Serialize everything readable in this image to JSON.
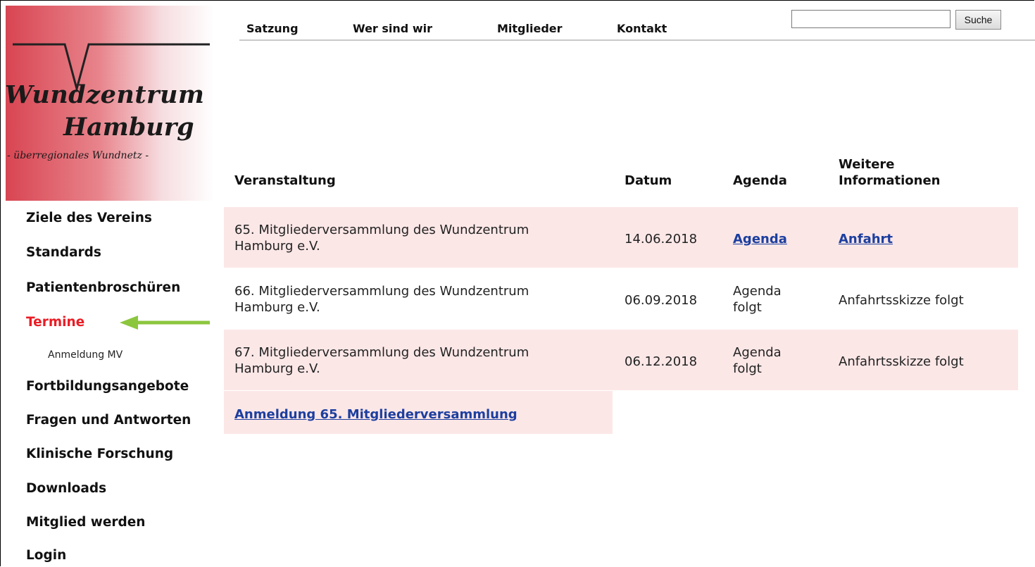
{
  "logo": {
    "line1": "Wundzentrum",
    "line2": "Hamburg",
    "subtitle": "- überregionales Wundnetz -"
  },
  "topnav": {
    "items": [
      "Satzung",
      "Wer sind wir",
      "Mitglieder",
      "Kontakt"
    ]
  },
  "search": {
    "value": "",
    "button_label": "Suche"
  },
  "sidebar": {
    "items": [
      "Ziele des Vereins",
      "Standards",
      "Patientenbroschüren",
      "Termine",
      "Anmeldung MV",
      "Fortbildungsangebote",
      "Fragen und Antworten",
      "Klinische Forschung",
      "Downloads",
      "Mitglied werden",
      "Login"
    ],
    "active": "Termine"
  },
  "table": {
    "headers": {
      "event": "Veranstaltung",
      "date": "Datum",
      "agenda": "Agenda",
      "info_line1": "Weitere",
      "info_line2": "Informationen"
    },
    "rows": [
      {
        "event_line1": "65. Mitgliederversammlung des Wundzentrum",
        "event_line2": "Hamburg e.V.",
        "date": "14.06.2018",
        "agenda": "Agenda",
        "info": "Anfahrt"
      },
      {
        "event_line1": "66. Mitgliederversammlung des Wundzentrum",
        "event_line2": "Hamburg e.V.",
        "date": "06.09.2018",
        "agenda_line1": "Agenda",
        "agenda_line2": "folgt",
        "info": "Anfahrtsskizze folgt"
      },
      {
        "event_line1": "67. Mitgliederversammlung des Wundzentrum",
        "event_line2": "Hamburg e.V.",
        "date": "06.12.2018",
        "agenda_line1": "Agenda",
        "agenda_line2": "folgt",
        "info": "Anfahrtsskizze folgt"
      }
    ]
  },
  "registration_link": "Anmeldung 65. Mitgliederversammlung",
  "colors": {
    "active_nav": "#ea1c24",
    "link": "#1c3f9f",
    "row_highlight": "#fce7e7",
    "arrow": "#8cc63f"
  }
}
